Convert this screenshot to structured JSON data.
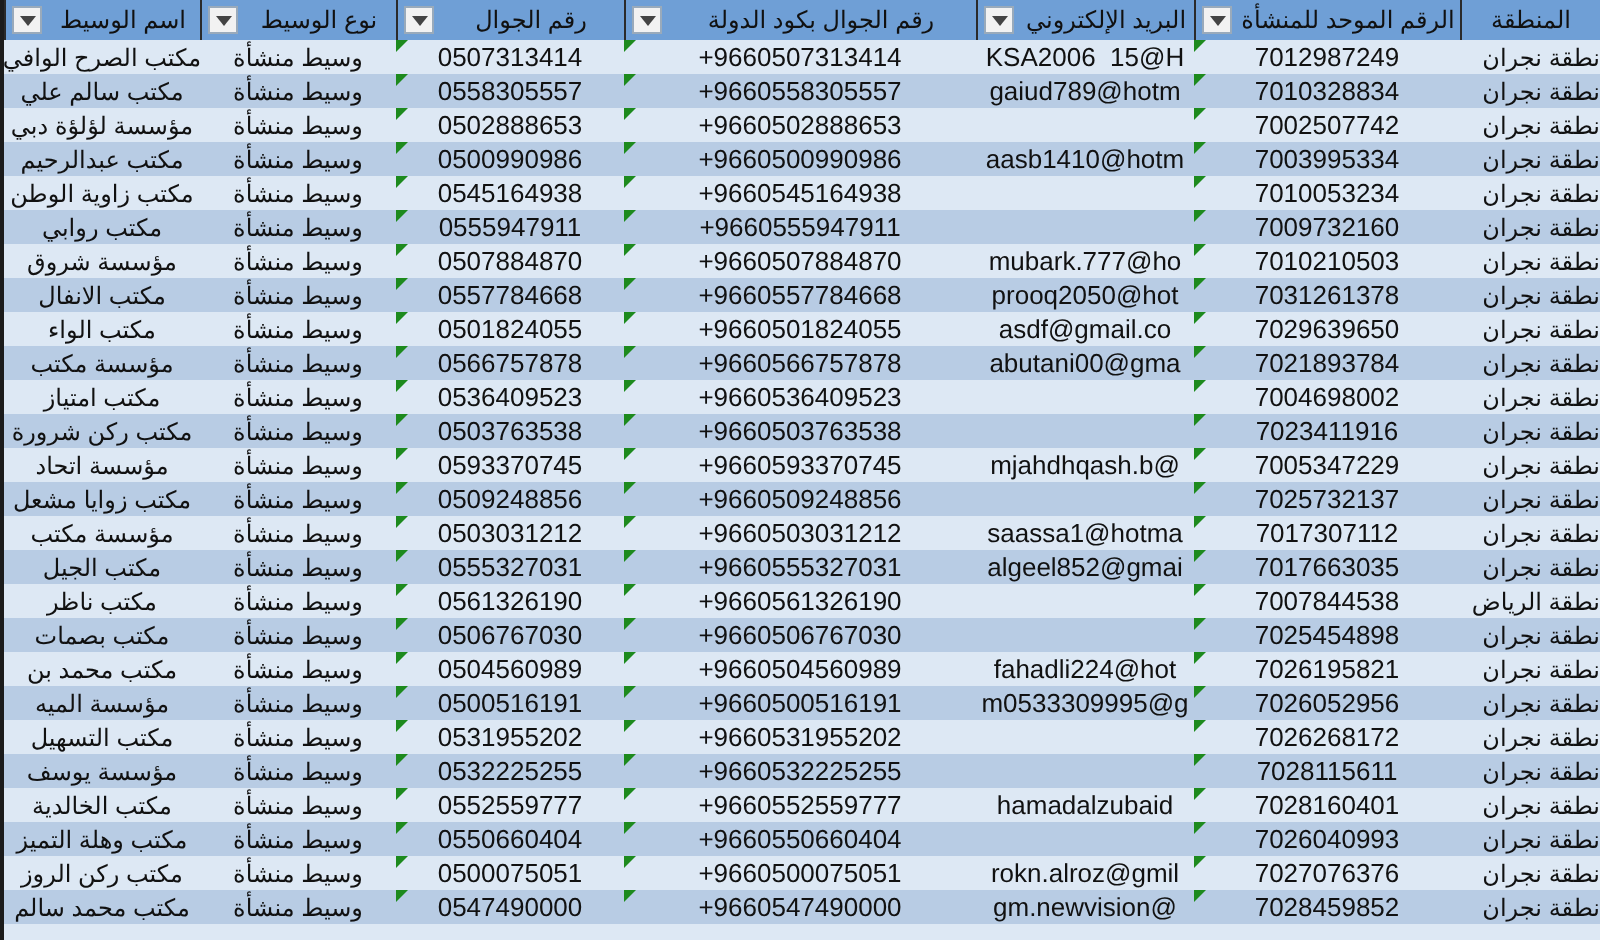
{
  "table": {
    "columns": [
      {
        "label": "المنطقة",
        "filter": false,
        "number_as_text": false
      },
      {
        "label": "الرقم الموحد للمنشأة",
        "filter": true,
        "number_as_text": true
      },
      {
        "label": "البريد الإلكتروني",
        "filter": true,
        "number_as_text": false
      },
      {
        "label": "رقم الجوال بكود الدولة",
        "filter": true,
        "number_as_text": true
      },
      {
        "label": "رقم الجوال",
        "filter": true,
        "number_as_text": true
      },
      {
        "label": "نوع الوسيط",
        "filter": true,
        "number_as_text": false
      },
      {
        "label": "اسم الوسيط",
        "filter": true,
        "number_as_text": false
      }
    ],
    "rows": [
      {
        "region": "نطقة نجران",
        "unified_number": "7012987249",
        "email": "KSA2006  15@H",
        "mobile_intl": "+9660507313414",
        "mobile": "0507313414",
        "broker_type": "وسيط منشأة",
        "broker_name": "مكتب الصرح الوافي"
      },
      {
        "region": "نطقة نجران",
        "unified_number": "7010328834",
        "email": "gaiud789@hotm",
        "mobile_intl": "+9660558305557",
        "mobile": "0558305557",
        "broker_type": "وسيط منشأة",
        "broker_name": "مكتب سالم علي"
      },
      {
        "region": "نطقة نجران",
        "unified_number": "7002507742",
        "mobile_intl": "+9660502888653",
        "mobile": "0502888653",
        "broker_type": "وسيط منشأة",
        "broker_name": "مؤسسة لؤلؤة دبي"
      },
      {
        "region": "نطقة نجران",
        "unified_number": "7003995334",
        "email": "aasb1410@hotm",
        "mobile_intl": "+9660500990986",
        "mobile": "0500990986",
        "broker_type": "وسيط منشأة",
        "broker_name": "مكتب عبدالرحيم"
      },
      {
        "region": "نطقة نجران",
        "unified_number": "7010053234",
        "mobile_intl": "+9660545164938",
        "mobile": "0545164938",
        "broker_type": "وسيط منشأة",
        "broker_name": "مكتب زاوية الوطن"
      },
      {
        "region": "نطقة نجران",
        "unified_number": "7009732160",
        "mobile_intl": "+9660555947911",
        "mobile": "0555947911",
        "broker_type": "وسيط منشأة",
        "broker_name": "مكتب روابي"
      },
      {
        "region": "نطقة نجران",
        "unified_number": "7010210503",
        "email": "mubark.777@ho",
        "mobile_intl": "+9660507884870",
        "mobile": "0507884870",
        "broker_type": "وسيط منشأة",
        "broker_name": "مؤسسة شروق"
      },
      {
        "region": "نطقة نجران",
        "unified_number": "7031261378",
        "email": "prooq2050@hot",
        "mobile_intl": "+9660557784668",
        "mobile": "0557784668",
        "broker_type": "وسيط منشأة",
        "broker_name": "مكتب الانفال"
      },
      {
        "region": "نطقة نجران",
        "unified_number": "7029639650",
        "email": "asdf@gmail.co",
        "mobile_intl": "+9660501824055",
        "mobile": "0501824055",
        "broker_type": "وسيط منشأة",
        "broker_name": "مكتب الواء"
      },
      {
        "region": "نطقة نجران",
        "unified_number": "7021893784",
        "email": "abutani00@gma",
        "mobile_intl": "+9660566757878",
        "mobile": "0566757878",
        "broker_type": "وسيط منشأة",
        "broker_name": "مؤسسة مكتب"
      },
      {
        "region": "نطقة نجران",
        "unified_number": "7004698002",
        "mobile_intl": "+9660536409523",
        "mobile": "0536409523",
        "broker_type": "وسيط منشأة",
        "broker_name": "مكتب امتياز"
      },
      {
        "region": "نطقة نجران",
        "unified_number": "7023411916",
        "mobile_intl": "+9660503763538",
        "mobile": "0503763538",
        "broker_type": "وسيط منشأة",
        "broker_name": "مكتب ركن شرورة"
      },
      {
        "region": "نطقة نجران",
        "unified_number": "7005347229",
        "email": "mjahdhqash.b@",
        "mobile_intl": "+9660593370745",
        "mobile": "0593370745",
        "broker_type": "وسيط منشأة",
        "broker_name": "مؤسسة اتحاد"
      },
      {
        "region": "نطقة نجران",
        "unified_number": "7025732137",
        "mobile_intl": "+9660509248856",
        "mobile": "0509248856",
        "broker_type": "وسيط منشأة",
        "broker_name": "مكتب زوايا مشعل"
      },
      {
        "region": "نطقة نجران",
        "unified_number": "7017307112",
        "email": "saassa1@hotma",
        "mobile_intl": "+9660503031212",
        "mobile": "0503031212",
        "broker_type": "وسيط منشأة",
        "broker_name": "مؤسسة مكتب"
      },
      {
        "region": "نطقة نجران",
        "unified_number": "7017663035",
        "email": "algeel852@gmai",
        "mobile_intl": "+9660555327031",
        "mobile": "0555327031",
        "broker_type": "وسيط منشأة",
        "broker_name": "مكتب الجيل"
      },
      {
        "region": "نطقة الرياض",
        "unified_number": "7007844538",
        "mobile_intl": "+9660561326190",
        "mobile": "0561326190",
        "broker_type": "وسيط منشأة",
        "broker_name": "مكتب ناظر"
      },
      {
        "region": "نطقة نجران",
        "unified_number": "7025454898",
        "mobile_intl": "+9660506767030",
        "mobile": "0506767030",
        "broker_type": "وسيط منشأة",
        "broker_name": "مكتب بصمات"
      },
      {
        "region": "نطقة نجران",
        "unified_number": "7026195821",
        "email": "fahadli224@hot",
        "mobile_intl": "+9660504560989",
        "mobile": "0504560989",
        "broker_type": "وسيط منشأة",
        "broker_name": "مكتب محمد بن"
      },
      {
        "region": "نطقة نجران",
        "unified_number": "7026052956",
        "email": "m0533309995@g",
        "mobile_intl": "+9660500516191",
        "mobile": "0500516191",
        "broker_type": "وسيط منشأة",
        "broker_name": "مؤسسة الميه"
      },
      {
        "region": "نطقة نجران",
        "unified_number": "7026268172",
        "mobile_intl": "+9660531955202",
        "mobile": "0531955202",
        "broker_type": "وسيط منشأة",
        "broker_name": "مكتب التسهيل"
      },
      {
        "region": "نطقة نجران",
        "unified_number": "7028115611",
        "mobile_intl": "+9660532225255",
        "mobile": "0532225255",
        "broker_type": "وسيط منشأة",
        "broker_name": "مؤسسة يوسف"
      },
      {
        "region": "نطقة نجران",
        "unified_number": "7028160401",
        "email": "hamadalzubaid",
        "mobile_intl": "+9660552559777",
        "mobile": "0552559777",
        "broker_type": "وسيط منشأة",
        "broker_name": "مكتب الخالدية"
      },
      {
        "region": "نطقة نجران",
        "unified_number": "7026040993",
        "mobile_intl": "+9660550660404",
        "mobile": "0550660404",
        "broker_type": "وسيط منشأة",
        "broker_name": "مكتب وهلة التميز"
      },
      {
        "region": "نطقة نجران",
        "unified_number": "7027076376",
        "email": "rokn.alroz@gmil",
        "mobile_intl": "+9660500075051",
        "mobile": "0500075051",
        "broker_type": "وسيط منشأة",
        "broker_name": "مكتب ركن الروز"
      },
      {
        "region": "نطقة نجران",
        "unified_number": "7028459852",
        "email": "gm.newvision@",
        "mobile_intl": "+9660547490000",
        "mobile": "0547490000",
        "broker_type": "وسيط منشأة",
        "broker_name": "مكتب محمد سالم"
      }
    ]
  }
}
